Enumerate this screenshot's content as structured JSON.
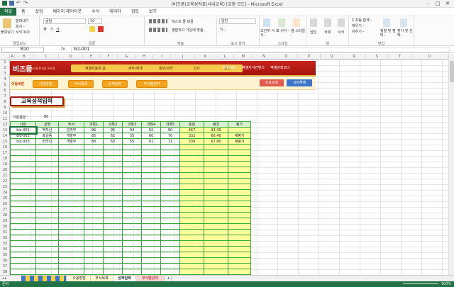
{
  "window": {
    "title": "(비즈폼)교육성적표(사내교육) [호환 모드] - Microsoft Excel"
  },
  "ribbon_tabs": [
    "파일",
    "홈",
    "삽입",
    "페이지 레이아웃",
    "수식",
    "데이터",
    "검토",
    "보기"
  ],
  "ribbon": {
    "clipboard": {
      "paste": "붙여넣기",
      "cut": "잘라내기",
      "copy": "복사 -",
      "format_painter": "서식 복사",
      "name": "클립보드"
    },
    "font": {
      "font_name": "굴림",
      "font_size": "10",
      "name": "글꼴"
    },
    "alignment": {
      "wrap": "텍스트 줄 바꿈",
      "merge": "병합하고 가운데 맞춤 -",
      "name": "맞춤"
    },
    "number": {
      "format": "일반",
      "name": "표시 형식"
    },
    "styles": {
      "conditional": "조건부 서식 -",
      "table": "표 서식 -",
      "cell": "셀 스타일 -",
      "name": "스타일"
    },
    "cells": {
      "insert": "삽입",
      "delete": "삭제",
      "format": "서식",
      "name": "셀"
    },
    "editing": {
      "autosum": "Σ 자동 합계 -",
      "fill": "채우기 -",
      "clear": "지우기 -",
      "sort": "정렬 및 필터 -",
      "find": "찾기 및 선택 -",
      "name": "편집"
    }
  },
  "formula_bar": {
    "name_box": "B10",
    "fx": "fx",
    "value": "biz-001"
  },
  "columns": [
    "A",
    "B",
    "C",
    "D",
    "E",
    "F",
    "G",
    "H",
    "I",
    "J",
    "K",
    "L",
    "M",
    "N",
    "O",
    "P",
    "Q",
    "R",
    "S",
    "T",
    "U"
  ],
  "row_numbers": [
    "1",
    "2",
    "3",
    "4",
    "5",
    "6",
    "7",
    "8",
    "9",
    "10",
    "11",
    "12",
    "13",
    "14",
    "15",
    "16",
    "17",
    "18",
    "19",
    "20",
    "21",
    "22",
    "23",
    "24",
    "25",
    "26",
    "27",
    "28",
    "29",
    "30",
    "31",
    "32",
    "33",
    "34",
    "35",
    "36",
    "37",
    "38"
  ],
  "banner": {
    "logo": "비즈폼",
    "logo_sub": "문서서식전문기업 비즈폼",
    "nav": [
      "액셀자동화 홈",
      "세무/회계",
      "총무/관리",
      "인사",
      "일반"
    ],
    "links": [
      "액셀FAQ",
      "액셀지식컨텐츠",
      "액셀강좌코너"
    ]
  },
  "subbar": {
    "label": "이동버튼",
    "buttons": [
      "사용방법",
      "부서목록",
      "성적입력",
      "부서별성적"
    ],
    "right_buttons": [
      "시트보호",
      "시트해제"
    ]
  },
  "heading": "교육성적입력",
  "standard": {
    "label": "기준평균 :",
    "value": "80"
  },
  "table": {
    "headers": [
      "사번",
      "성명",
      "부서",
      "과목1",
      "과목2",
      "과목3",
      "과목4",
      "과목5",
      "총점",
      "평균",
      "평가"
    ],
    "rows": [
      [
        "biz-001",
        "백두산",
        "관리부",
        "96",
        "95",
        "94",
        "92",
        "90",
        "467",
        "93.40",
        ""
      ],
      [
        "biz-002",
        "홍길동",
        "개발부",
        "85",
        "62",
        "55",
        "60",
        "70",
        "332",
        "66.40",
        "재평가"
      ],
      [
        "biz-003",
        "한라산",
        "개발부",
        "88",
        "63",
        "55",
        "61",
        "71",
        "339",
        "67.80",
        "재평가"
      ]
    ]
  },
  "sheet_tabs": [
    "사용방법",
    "부서목록",
    "성적입력",
    "부서별성적"
  ],
  "status": {
    "ready": "준비",
    "zoom": "100%"
  },
  "colors": {
    "excel_green": "#217346",
    "banner_red": "#b51c14",
    "button_orange": "#f5a31b",
    "grid_green": "#38a838",
    "sum_yellow": "#ffff9e"
  }
}
